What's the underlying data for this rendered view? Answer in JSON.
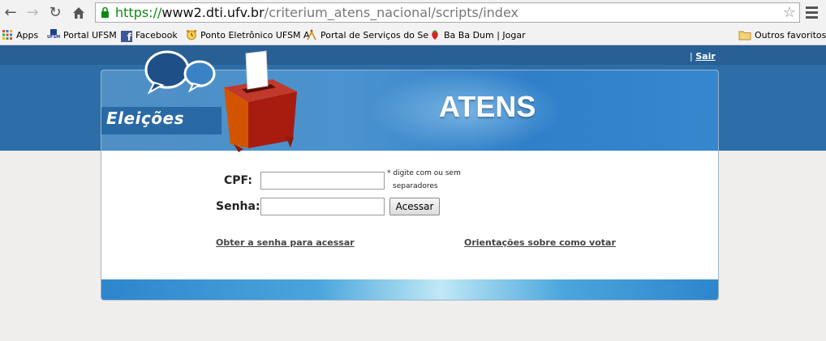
{
  "browser": {
    "url_scheme": "https://",
    "url_host": "www2.dti.ufv.br",
    "url_path": "/criterium_atens_nacional/scripts/index",
    "bookmarks": [
      {
        "label": "Apps"
      },
      {
        "label": "Portal UFSM"
      },
      {
        "label": "Facebook"
      },
      {
        "label": "Ponto Eletrônico UFSM A"
      },
      {
        "label": "Portal de Serviços do Se"
      },
      {
        "label": "Ba Ba Dum | Jogar"
      }
    ],
    "other_bookmarks": "Outros favoritos",
    "ufsm_badge": "UFSM"
  },
  "header": {
    "separator": "|",
    "logout_label": "Sair",
    "brand_left": "Eleições",
    "brand_title": "ATENS"
  },
  "form": {
    "cpf_label": "CPF:",
    "cpf_value": "",
    "cpf_hint_line1": "* digite com ou sem",
    "cpf_hint_line2": "separadores",
    "password_label": "Senha:",
    "password_value": "",
    "submit_label": "Acessar"
  },
  "links": {
    "get_password": "Obter a senha para acessar",
    "voting_guide": "Orientações sobre como votar"
  },
  "colors": {
    "page_top": "#2d6ea8",
    "url_green": "#0b8a12",
    "ballot_box": "#a81c10"
  }
}
